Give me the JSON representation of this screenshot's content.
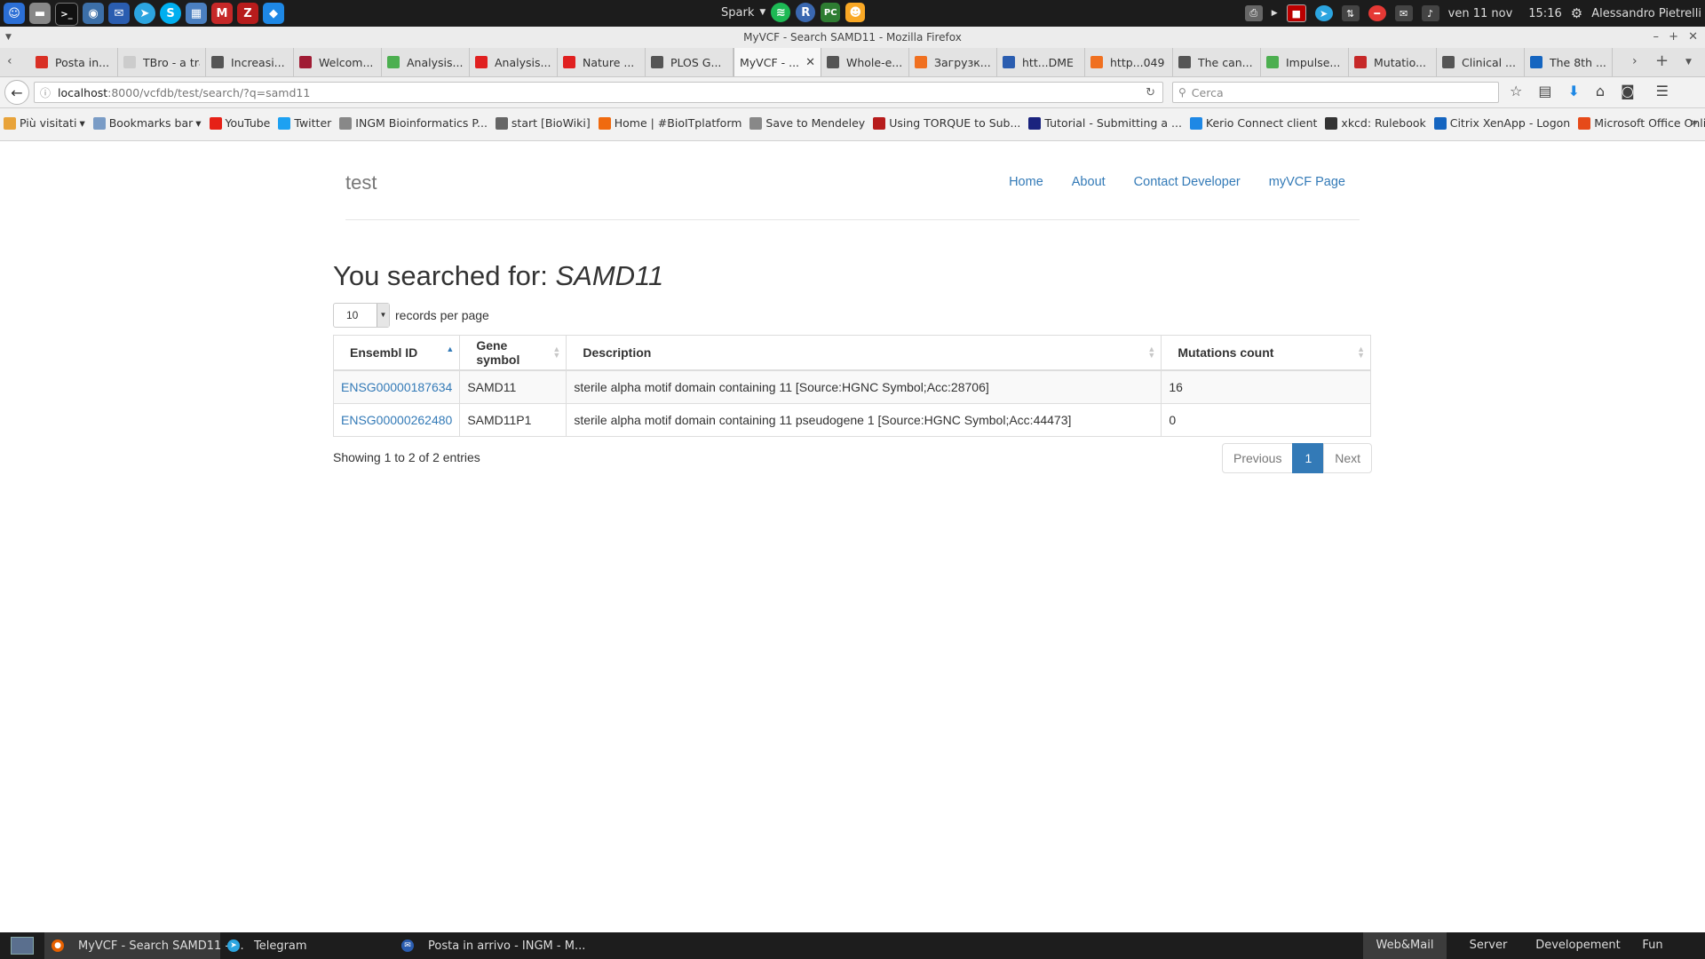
{
  "system_panel": {
    "spark_label": "Spark",
    "date": "ven 11 nov",
    "time": "15:16",
    "user": "Alessandro Pietrelli",
    "launcher_icons": [
      "finder-icon",
      "files-icon",
      "terminal-icon",
      "network-icon",
      "thunderbird-icon",
      "telegram-icon",
      "skype-icon",
      "monitor-icon",
      "mendeley-icon",
      "filezilla-icon",
      "dropbox-icon"
    ]
  },
  "window": {
    "title": "MyVCF - Search SAMD11 - Mozilla Firefox"
  },
  "tabs": [
    {
      "label": "Posta in...",
      "icon": "gmail-icon",
      "color": "#d93025"
    },
    {
      "label": "TBro - a tra...",
      "icon": "blank-icon",
      "color": "#cccccc"
    },
    {
      "label": "Increasi...",
      "icon": "bioinfo-icon",
      "color": "#555555"
    },
    {
      "label": "Welcom...",
      "icon": "welcome-icon",
      "color": "#a01c34"
    },
    {
      "label": "Analysis...",
      "icon": "analysis-icon",
      "color": "#4caf50"
    },
    {
      "label": "Analysis...",
      "icon": "nature-icon",
      "color": "#e02020"
    },
    {
      "label": "Nature ...",
      "icon": "nature-icon",
      "color": "#e02020"
    },
    {
      "label": "PLOS G...",
      "icon": "plos-icon",
      "color": "#555555"
    },
    {
      "label": "MyVCF - ...",
      "icon": "none",
      "color": "#ffffff",
      "active": true
    },
    {
      "label": "Whole-e...",
      "icon": "bioinfo-icon",
      "color": "#555555"
    },
    {
      "label": "Загрузк...",
      "icon": "download-icon",
      "color": "#f07020"
    },
    {
      "label": "htt...DME",
      "icon": "table-icon",
      "color": "#2a5db0"
    },
    {
      "label": "http...049",
      "icon": "download-icon",
      "color": "#f07020"
    },
    {
      "label": "The can...",
      "icon": "bioinfo-icon",
      "color": "#555555"
    },
    {
      "label": "Impulse...",
      "icon": "analysis-icon",
      "color": "#4caf50"
    },
    {
      "label": "Mutatio...",
      "icon": "s-icon",
      "color": "#c62828"
    },
    {
      "label": "Clinical ...",
      "icon": "bioinfo-icon",
      "color": "#555555"
    },
    {
      "label": "The 8th ...",
      "icon": "blue-icon",
      "color": "#1565c0"
    }
  ],
  "navbar": {
    "url_host": "localhost",
    "url_rest": ":8000/vcfdb/test/search/?q=samd11",
    "search_placeholder": "Cerca"
  },
  "bookmarks": [
    {
      "label": "Più visitati",
      "icon": "folder-icon",
      "color": "#e8a33a",
      "dropdown": true
    },
    {
      "label": "Bookmarks bar",
      "icon": "folder-icon",
      "color": "#7a9cc6",
      "dropdown": true
    },
    {
      "label": "YouTube",
      "icon": "youtube-icon",
      "color": "#e62117"
    },
    {
      "label": "Twitter",
      "icon": "twitter-icon",
      "color": "#1da1f2"
    },
    {
      "label": "INGM Bioinformatics P...",
      "icon": "globe-icon",
      "color": "#888888"
    },
    {
      "label": "start [BioWiki]",
      "icon": "wiki-icon",
      "color": "#666666"
    },
    {
      "label": "Home | #BioITplatform",
      "icon": "bioit-icon",
      "color": "#f06a0f"
    },
    {
      "label": "Save to Mendeley",
      "icon": "globe-icon",
      "color": "#888888"
    },
    {
      "label": "Using TORQUE to Sub...",
      "icon": "torque-icon",
      "color": "#b71c1c"
    },
    {
      "label": "Tutorial - Submitting a ...",
      "icon": "tutorial-icon",
      "color": "#1a237e"
    },
    {
      "label": "Kerio Connect client",
      "icon": "mail-icon",
      "color": "#1e88e5"
    },
    {
      "label": "xkcd: Rulebook",
      "icon": "xkcd-icon",
      "color": "#333333"
    },
    {
      "label": "Citrix XenApp - Logon",
      "icon": "citrix-icon",
      "color": "#1565c0"
    },
    {
      "label": "Microsoft Office Online...",
      "icon": "office-icon",
      "color": "#e64a19"
    }
  ],
  "site": {
    "brand": "test",
    "nav": [
      "Home",
      "About",
      "Contact Developer",
      "myVCF Page"
    ],
    "link_color": "#337ab7"
  },
  "search": {
    "prefix": "You searched for: ",
    "query": "SAMD11",
    "page_length": "10",
    "records_label": "records per page"
  },
  "table": {
    "columns": [
      "Ensembl ID",
      "Gene symbol",
      "Description",
      "Mutations count"
    ],
    "rows": [
      {
        "ensembl_id": "ENSG00000187634",
        "symbol": "SAMD11",
        "description": "sterile alpha motif domain containing 11 [Source:HGNC Symbol;Acc:28706]",
        "count": "16"
      },
      {
        "ensembl_id": "ENSG00000262480",
        "symbol": "SAMD11P1",
        "description": "sterile alpha motif domain containing 11 pseudogene 1 [Source:HGNC Symbol;Acc:44473]",
        "count": "0"
      }
    ],
    "info": "Showing 1 to 2 of 2 entries",
    "pager": {
      "prev": "Previous",
      "current": "1",
      "next": "Next"
    }
  },
  "taskbar": {
    "tasks": [
      {
        "label": "MyVCF - Search SAMD11 - ...",
        "icon": "firefox-icon",
        "active": true
      },
      {
        "label": "Telegram",
        "icon": "telegram-icon",
        "active": false
      },
      {
        "label": "Posta in arrivo - INGM - M...",
        "icon": "thunderbird-icon",
        "active": false
      }
    ],
    "workspaces": [
      {
        "label": "Web&Mail",
        "active": true
      },
      {
        "label": "Server",
        "active": false
      },
      {
        "label": "Developement",
        "active": false
      },
      {
        "label": "Fun",
        "active": false
      }
    ]
  }
}
